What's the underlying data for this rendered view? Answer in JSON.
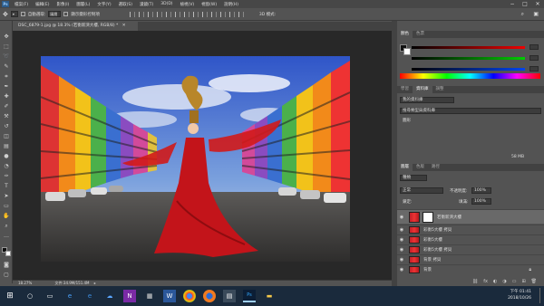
{
  "menu": {
    "logo": "Ps",
    "items": [
      "檔案(F)",
      "編輯(E)",
      "影像(I)",
      "圖層(L)",
      "文字(Y)",
      "選取(S)",
      "濾鏡(T)",
      "3D(D)",
      "檢視(V)",
      "視窗(W)",
      "說明(H)"
    ],
    "window_controls": [
      "−",
      "□",
      "✕"
    ]
  },
  "options_bar": {
    "auto_select_label": "自動選取:",
    "auto_select_value": "圖層",
    "transform_label": "顯示變形控制項"
  },
  "document": {
    "tab_title": "DSC_6879-1.jpg @ 18.3% (若衡新濟大樓, RGB/8) *",
    "tab_close": "✕"
  },
  "status": {
    "zoom": "18.27%",
    "doc_info": "文件:34.9M/151.4M"
  },
  "panels": {
    "color_tabs": [
      "顏色",
      "色票"
    ],
    "adjust_tabs": [
      "學習",
      "資料庫",
      "調整"
    ],
    "library_dropdown": "我的資料庫",
    "search_dropdown": "搜尋類型與資料庫",
    "library_section": "圖形",
    "library_size": "58 MB",
    "layers_tabs": [
      "圖層",
      "色版",
      "路徑"
    ],
    "kind_dropdown": "種類",
    "blend_mode": "正常",
    "opacity_label": "不透明度:",
    "opacity_value": "100%",
    "lock_label": "鎖定:",
    "fill_label": "填滿:",
    "fill_value": "100%",
    "layers": [
      {
        "name": "若衡新濟大樓",
        "selected": true,
        "locked": false
      },
      {
        "name": "彩衡5大樓 拷貝",
        "selected": false,
        "locked": false
      },
      {
        "name": "彩衡5大樓",
        "selected": false,
        "locked": false
      },
      {
        "name": "彩衡5大樓 拷貝",
        "selected": false,
        "locked": false
      },
      {
        "name": "背景 拷貝",
        "selected": false,
        "locked": false
      },
      {
        "name": "背景",
        "selected": false,
        "locked": true
      }
    ],
    "colors": {
      "red": "#cc2222",
      "green": "#22aa22",
      "blue": "#2244cc"
    }
  },
  "taskbar": {
    "clock_time": "下午 01:41",
    "clock_date": "2018/10/26",
    "icons": [
      "windows-logo-icon",
      "search-icon",
      "task-view-icon",
      "ie-icon",
      "edge-icon",
      "onedrive-icon",
      "onenote-icon",
      "store-icon",
      "word-icon",
      "chrome-icon",
      "firefox-icon",
      "app-icon",
      "photoshop-icon",
      "explorer-icon"
    ]
  }
}
